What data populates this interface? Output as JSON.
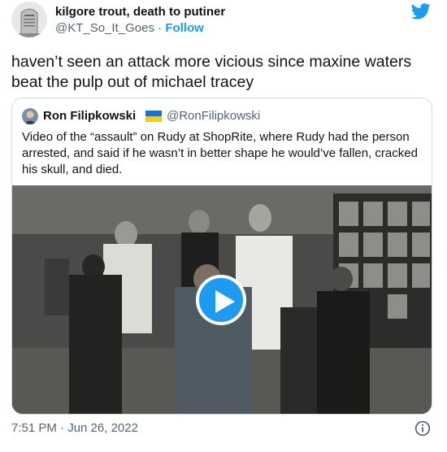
{
  "author": {
    "name": "kilgore trout, death to putiner",
    "handle": "@KT_So_It_Goes",
    "separator": " · ",
    "follow_label": "Follow",
    "avatar_icon": "tombstone-avatar-icon"
  },
  "brand_icon": "twitter-bird-icon",
  "tweet_text": "haven’t seen an attack more vicious since maxine waters beat the pulp out of michael tracey",
  "quoted": {
    "name": "Ron Filipkowski",
    "flag_icon": "ukraine-flag-icon",
    "handle": "@RonFilipkowski",
    "text": "Video of the “assault” on Rudy at ShopRite, where Rudy had the person arrested, and said if he wasn’t in better shape he would’ve fallen, cracked his skull, and died.",
    "video": {
      "play_icon": "play-icon"
    }
  },
  "timestamp": "7:51 PM · Jun 26, 2022",
  "info_icon": "info-icon",
  "colors": {
    "accent": "#1d9bf0",
    "text": "#0f1419",
    "muted": "#536471",
    "border": "#cfd9de"
  }
}
